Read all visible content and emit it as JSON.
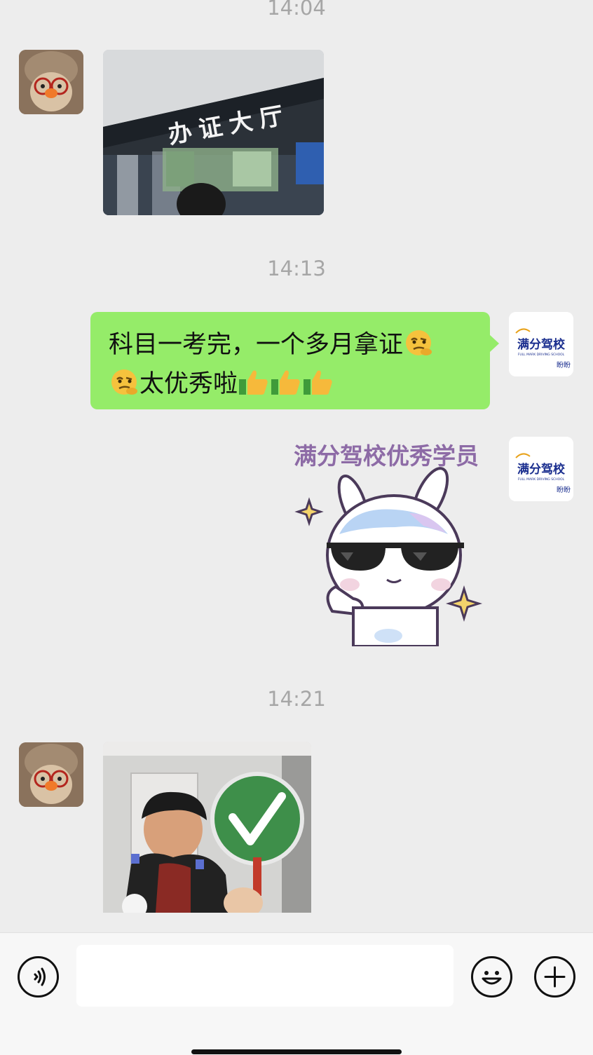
{
  "timestamps": [
    "14:04",
    "14:13",
    "14:21"
  ],
  "messages": {
    "photo_sign": "办证大厅",
    "text_line1": "科目一考完，一个多月拿证",
    "text_line2": "太优秀啦",
    "sticker_caption": "满分驾校优秀学员"
  },
  "self_avatar": {
    "brand": "满分驾校",
    "brand_en": "FULL MARK DRIVING SCHOOL",
    "name": "盼盼"
  },
  "colors": {
    "background": "#ededed",
    "bubble_green": "#95ec69",
    "timestamp_gray": "#a6a6a6",
    "brand_blue": "#1b2f8f"
  },
  "input_bar": {
    "icons": [
      "voice-icon",
      "emoji-icon",
      "plus-icon"
    ]
  }
}
